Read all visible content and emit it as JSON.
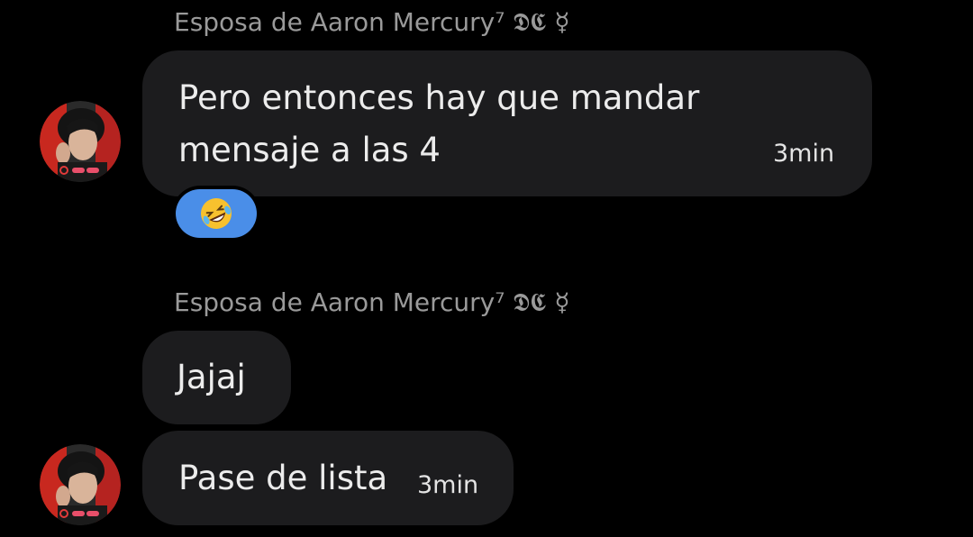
{
  "messages": [
    {
      "sender": "Esposa de Aaron Mercury⁷ 𝕯𝕮 ☿",
      "bubbles": [
        {
          "lines": [
            "Pero entonces hay que mandar",
            "mensaje a las 4"
          ],
          "time": "3min"
        }
      ],
      "reaction": {
        "emoji": "🤣",
        "icon": "rolling-on-floor-laughing-icon"
      }
    },
    {
      "sender": "Esposa de Aaron Mercury⁷ 𝕯𝕮 ☿",
      "bubbles": [
        {
          "text": "Jajaj"
        },
        {
          "text": "Pase de lista",
          "time": "3min"
        }
      ]
    }
  ],
  "colors": {
    "background": "#000000",
    "bubble": "#1c1c1e",
    "sender_text": "#9a9a9a",
    "message_text": "#ececec",
    "reaction_bg": "#4a8ee8"
  }
}
